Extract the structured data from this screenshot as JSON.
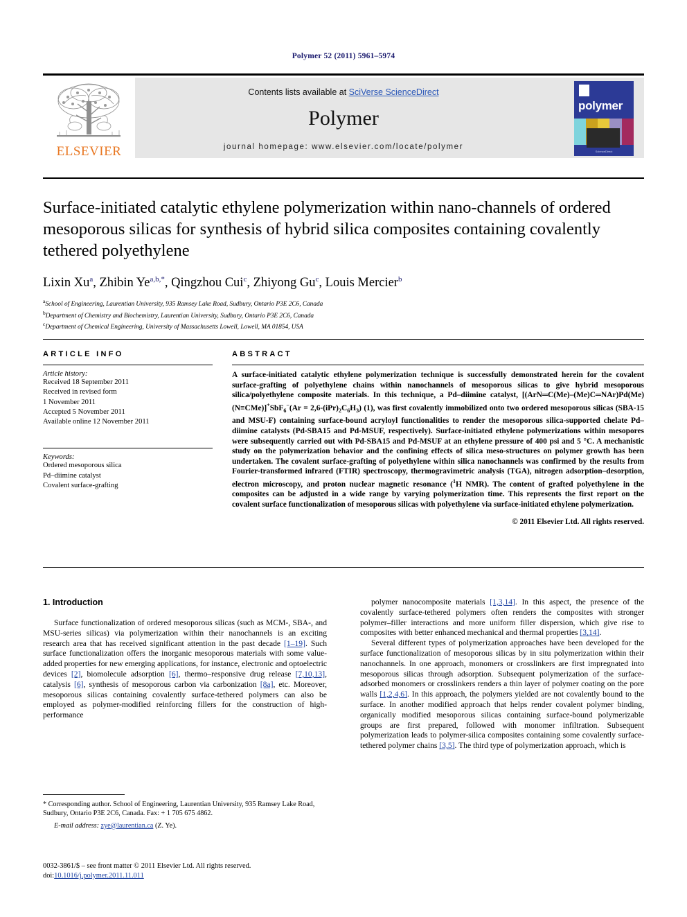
{
  "running_head": "Polymer 52 (2011) 5961–5974",
  "masthead": {
    "contents_prefix": "Contents lists available at ",
    "sciencedirect": "SciVerse ScienceDirect",
    "journal_name": "Polymer",
    "homepage": "journal homepage: www.elsevier.com/locate/polymer",
    "publisher_logo_text": "ELSEVIER",
    "cover_title": "polymer",
    "cover_footer": "ScienceDirect"
  },
  "article": {
    "title": "Surface-initiated catalytic ethylene polymerization within nano-channels of ordered mesoporous silicas for synthesis of hybrid silica composites containing covalently tethered polyethylene",
    "authors": [
      {
        "name": "Lixin Xu",
        "sup": "a"
      },
      {
        "name": "Zhibin Ye",
        "sup": "a,b,*"
      },
      {
        "name": "Qingzhou Cui",
        "sup": "c"
      },
      {
        "name": "Zhiyong Gu",
        "sup": "c"
      },
      {
        "name": "Louis Mercier",
        "sup": "b"
      }
    ],
    "affiliations": [
      {
        "marker": "a",
        "text": "School of Engineering, Laurentian University, 935 Ramsey Lake Road, Sudbury, Ontario P3E 2C6, Canada"
      },
      {
        "marker": "b",
        "text": "Department of Chemistry and Biochemistry, Laurentian University, Sudbury, Ontario P3E 2C6, Canada"
      },
      {
        "marker": "c",
        "text": "Department of Chemical Engineering, University of Massachusetts Lowell, Lowell, MA 01854, USA"
      }
    ]
  },
  "article_info": {
    "heading": "ARTICLE INFO",
    "history_label": "Article history:",
    "history": [
      "Received 18 September 2011",
      "Received in revised form",
      "1 November 2011",
      "Accepted 5 November 2011",
      "Available online 12 November 2011"
    ],
    "keywords_label": "Keywords:",
    "keywords": [
      "Ordered mesoporous silica",
      "Pd–diimine catalyst",
      "Covalent surface-grafting"
    ]
  },
  "abstract": {
    "heading": "ABSTRACT",
    "part1": "A surface-initiated catalytic ethylene polymerization technique is successfully demonstrated herein for the covalent surface-grafting of polyethylene chains within nanochannels of mesoporous silicas to give hybrid mesoporous silica/polyethylene composite materials. In this technique, a Pd–diimine catalyst, [(ArN",
    "formula_a": "C(Me)–(Me)C",
    "formula_b": "NAr)Pd(Me)(N",
    "formula_c": "CMe)]",
    "formula_sup1": "+",
    "formula_sbf": "SbF",
    "formula_sub6": "6",
    "formula_minus": "−",
    "part2": "(Ar = 2,6-(iPr)",
    "part2_sub": "2",
    "part2b": "C",
    "part2_sub2": "6",
    "part2c": "H",
    "part2_sub3": "3",
    "part2d": ") (1), was first covalently immobilized onto two ordered mesoporous silicas (SBA-15 and MSU-F) containing surface-bound acryloyl functionalities to render the mesoporous silica-supported chelate Pd–diimine catalysts (Pd-SBA15 and Pd-MSUF, respectively). Surface-initiated ethylene polymerizations within mesopores were subsequently carried out with Pd-SBA15 and Pd-MSUF at an ethylene pressure of 400 psi and 5 °C. A mechanistic study on the polymerization behavior and the confining effects of silica meso-structures on polymer growth has been undertaken. The covalent surface-grafting of polyethylene within silica nanochannels was confirmed by the results from Fourier-transformed infrared (FTIR) spectroscopy, thermogravimetric analysis (TGA), nitrogen adsorption–desorption, electron microscopy, and proton nuclear magnetic resonance (",
    "part3_sup": "1",
    "part3": "H NMR). The content of grafted polyethylene in the composites can be adjusted in a wide range by varying polymerization time. This represents the first report on the covalent surface functionalization of mesoporous silicas with polyethylene via surface-initiated ethylene polymerization.",
    "copyright": "© 2011 Elsevier Ltd. All rights reserved."
  },
  "introduction": {
    "section_title": "1. Introduction",
    "left_p1_a": "Surface functionalization of ordered mesoporous silicas (such as MCM-, SBA-, and MSU-series silicas) via polymerization within their nanochannels is an exciting research area that has received significant attention in the past decade ",
    "left_ref1": "[1–19]",
    "left_p1_b": ". Such surface functionalization offers the inorganic mesoporous materials with some value-added properties for new emerging applications, for instance, electronic and optoelectric devices ",
    "left_ref2": "[2]",
    "left_p1_c": ", biomolecule adsorption ",
    "left_ref3": "[6]",
    "left_p1_d": ", thermo–responsive drug release ",
    "left_ref4": "[7,10,13]",
    "left_p1_e": ", catalysis ",
    "left_ref5": "[6]",
    "left_p1_f": ", synthesis of mesoporous carbon via carbonization ",
    "left_ref6": "[8a]",
    "left_p1_g": ", etc. Moreover, mesoporous silicas containing covalently surface-tethered polymers can also be employed as polymer-modified reinforcing fillers for the construction of high-performance",
    "right_p1_a": "polymer nanocomposite materials ",
    "right_ref1": "[1,3,14]",
    "right_p1_b": ". In this aspect, the presence of the covalently surface-tethered polymers often renders the composites with stronger polymer–filler interactions and more uniform filler dispersion, which give rise to composites with better enhanced mechanical and thermal properties ",
    "right_ref2": "[3,14]",
    "right_p1_c": ".",
    "right_p2_a": "Several different types of polymerization approaches have been developed for the surface functionalization of mesoporous silicas by in situ polymerization within their nanochannels. In one approach, monomers or crosslinkers are first impregnated into mesoporous silicas through adsorption. Subsequent polymerization of the surface-adsorbed monomers or crosslinkers renders a thin layer of polymer coating on the pore walls ",
    "right_ref3": "[1,2,4,6]",
    "right_p2_b": ". In this approach, the polymers yielded are not covalently bound to the surface. In another modified approach that helps render covalent polymer binding, organically modified mesoporous silicas containing surface-bound polymerizable groups are first prepared, followed with monomer infiltration. Subsequent polymerization leads to polymer-silica composites containing some covalently surface-tethered polymer chains ",
    "right_ref4": "[3,5]",
    "right_p2_c": ". The third type of polymerization approach, which is"
  },
  "footnotes": {
    "corresponding": "* Corresponding author. School of Engineering, Laurentian University, 935 Ramsey Lake Road, Sudbury, Ontario P3E 2C6, Canada. Fax: + 1 705 675 4862.",
    "email_label": "E-mail address:",
    "email": "zye@laurentian.ca",
    "email_suffix": " (Z. Ye)."
  },
  "footer": {
    "issn_line": "0032-3861/$ – see front matter © 2011 Elsevier Ltd. All rights reserved.",
    "doi_label": "doi:",
    "doi": "10.1016/j.polymer.2011.11.011"
  },
  "colors": {
    "link": "#1a3fa0",
    "elsevier_orange": "#E87722",
    "cover_blue": "#2c3a96",
    "masthead_gray": "#e6e6e6"
  }
}
